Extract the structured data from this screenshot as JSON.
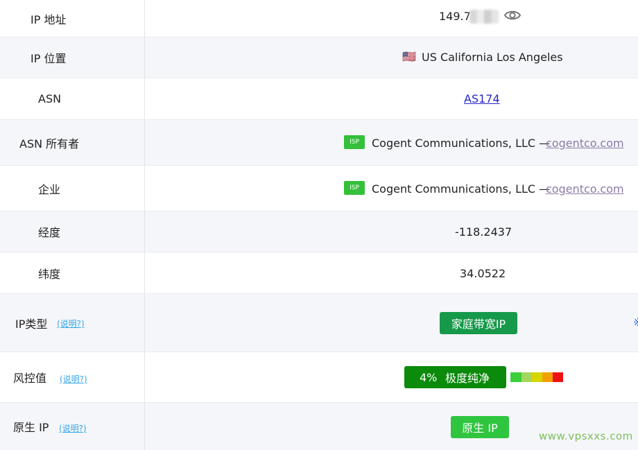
{
  "rows": {
    "ip_address": {
      "label": "IP 地址",
      "value": "149.7."
    },
    "ip_location": {
      "label": "IP 位置",
      "flag": "🇺🇸",
      "value": "US California Los Angeles"
    },
    "asn": {
      "label": "ASN",
      "value": "AS174"
    },
    "asn_owner": {
      "label": "ASN 所有者",
      "badge": "ISP",
      "company": "Cogent Communications, LLC —",
      "domain": "cogentco.com"
    },
    "enterprise": {
      "label": "企业",
      "badge": "ISP",
      "company": "Cogent Communications, LLC —",
      "domain": "cogentco.com"
    },
    "longitude": {
      "label": "经度",
      "value": "-118.2437"
    },
    "latitude": {
      "label": "纬度",
      "value": "34.0522"
    },
    "ip_type": {
      "label": "IP类型",
      "help": "(说明?)",
      "value": "家庭带宽IP",
      "edge_text": "※"
    },
    "risk": {
      "label": "风控值",
      "help": "(说明?)",
      "percent": "4%",
      "level": "极度纯净",
      "score": 0.04
    },
    "native_ip": {
      "label": "原生 IP",
      "help": "(说明?)",
      "value": "原生 IP"
    }
  },
  "watermark": "www.vpsxxs.com",
  "colors": {
    "isp_badge": "#34c03a",
    "ip_type_pill": "#16994a",
    "risk_pill": "#0b8a0b",
    "native_pill": "#2fc53f",
    "link": "#2626c9",
    "help": "#35a6e6",
    "risk_scale": [
      "#3bcf3b",
      "#a4d65e",
      "#d8d600",
      "#f2a000",
      "#ee1111"
    ]
  }
}
